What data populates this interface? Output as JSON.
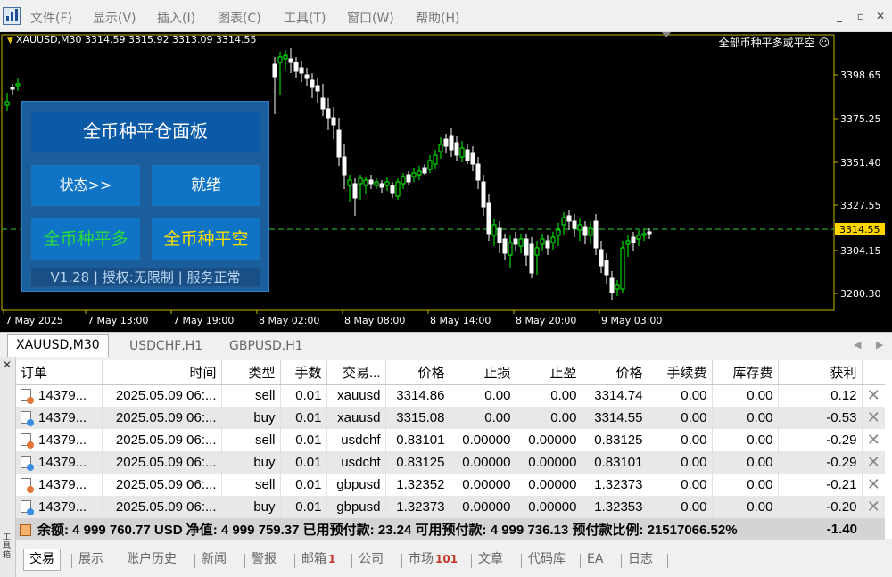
{
  "menu": {
    "items": [
      "文件(F)",
      "显示(V)",
      "插入(I)",
      "图表(C)",
      "工具(T)",
      "窗口(W)",
      "帮助(H)"
    ],
    "window_buttons": [
      "_",
      "▫",
      "✕"
    ]
  },
  "chart": {
    "header": "XAUUSD,M30  3314.59 3315.92 3313.09 3314.55",
    "ea_label": "全部币种平多或平空 ☺",
    "current_price": "3314.55",
    "price_ticks": [
      "3398.65",
      "3375.25",
      "3351.40",
      "3327.55",
      "3304.15",
      "3280.30"
    ],
    "time_ticks": [
      "7 May 2025",
      "7 May 13:00",
      "7 May 19:00",
      "8 May 02:00",
      "8 May 08:00",
      "8 May 14:00",
      "8 May 20:00",
      "9 May 03:00"
    ],
    "colors": {
      "bull": "#00ff00",
      "bear": "#ffffff",
      "axis": "#c8b400",
      "price_tag": "#ffd700"
    }
  },
  "panel": {
    "title": "全币种平仓面板",
    "status_button": "状态>>",
    "ready_label": "就绪",
    "close_long_button": "全币种平多",
    "close_short_button": "全币种平空",
    "version_text": "V1.28 | 授权:无限制 | 服务正常"
  },
  "chart_tabs": [
    "XAUUSD,M30",
    "USDCHF,H1",
    "GBPUSD,H1"
  ],
  "orders": {
    "columns": [
      "订单",
      "时间",
      "类型",
      "手数",
      "交易...",
      "价格",
      "止损",
      "止盈",
      "价格",
      "手续费",
      "库存费",
      "获利"
    ],
    "rows": [
      [
        "14379...",
        "2025.05.09 06:...",
        "sell",
        "0.01",
        "xauusd",
        "3314.86",
        "0.00",
        "0.00",
        "3314.74",
        "0.00",
        "0.00",
        "0.12"
      ],
      [
        "14379...",
        "2025.05.09 06:...",
        "buy",
        "0.01",
        "xauusd",
        "3315.08",
        "0.00",
        "0.00",
        "3314.55",
        "0.00",
        "0.00",
        "-0.53"
      ],
      [
        "14379...",
        "2025.05.09 06:...",
        "sell",
        "0.01",
        "usdchf",
        "0.83101",
        "0.00000",
        "0.00000",
        "0.83125",
        "0.00",
        "0.00",
        "-0.29"
      ],
      [
        "14379...",
        "2025.05.09 06:...",
        "buy",
        "0.01",
        "usdchf",
        "0.83125",
        "0.00000",
        "0.00000",
        "0.83101",
        "0.00",
        "0.00",
        "-0.29"
      ],
      [
        "14379...",
        "2025.05.09 06:...",
        "sell",
        "0.01",
        "gbpusd",
        "1.32352",
        "0.00000",
        "0.00000",
        "1.32373",
        "0.00",
        "0.00",
        "-0.21"
      ],
      [
        "14379...",
        "2025.05.09 06:...",
        "buy",
        "0.01",
        "gbpusd",
        "1.32373",
        "0.00000",
        "0.00000",
        "1.32353",
        "0.00",
        "0.00",
        "-0.20"
      ]
    ],
    "summary": "余额: 4 999 760.77 USD  净值: 4 999 759.37  已用预付款: 23.24  可用预付款: 4 999 736.13  预付款比例: 21517066.52%",
    "summary_profit": "-1.40"
  },
  "bottom_tabs": [
    {
      "label": "交易",
      "badge": ""
    },
    {
      "label": "展示",
      "badge": ""
    },
    {
      "label": "账户历史",
      "badge": ""
    },
    {
      "label": "新闻",
      "badge": ""
    },
    {
      "label": "警报",
      "badge": ""
    },
    {
      "label": "邮箱",
      "badge": "1"
    },
    {
      "label": "公司",
      "badge": ""
    },
    {
      "label": "市场",
      "badge": "101"
    },
    {
      "label": "文章",
      "badge": ""
    },
    {
      "label": "代码库",
      "badge": ""
    },
    {
      "label": "EA",
      "badge": ""
    },
    {
      "label": "日志",
      "badge": ""
    }
  ],
  "side_label": "工具箱"
}
